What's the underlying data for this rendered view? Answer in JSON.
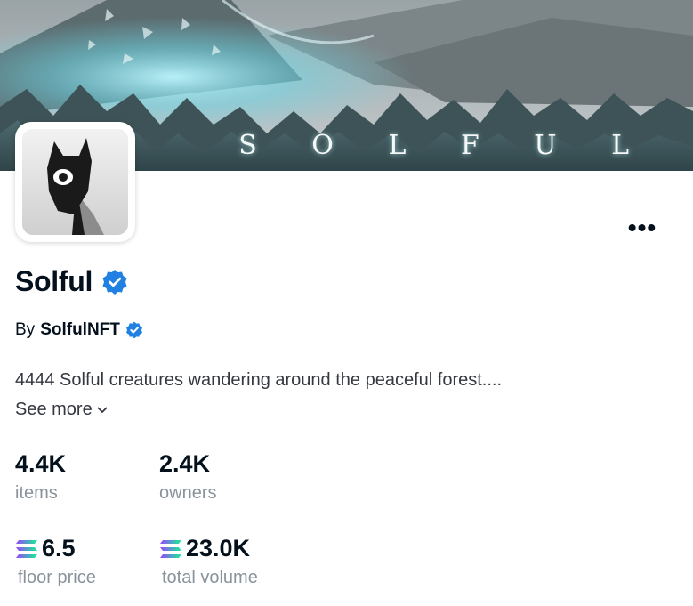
{
  "banner": {
    "wordmark": "S O L F U L"
  },
  "collection": {
    "name": "Solful",
    "by_prefix": "By",
    "creator": "SolfulNFT",
    "description": "4444 Solful creatures wandering around the peaceful forest....",
    "see_more": "See more"
  },
  "stats": {
    "items": {
      "value": "4.4K",
      "label": "items"
    },
    "owners": {
      "value": "2.4K",
      "label": "owners"
    },
    "floor_price": {
      "value": "6.5",
      "label": "floor price",
      "icon": "solana-icon"
    },
    "total_volume": {
      "value": "23.0K",
      "label": "total volume",
      "icon": "solana-icon"
    }
  },
  "colors": {
    "verified": "#2081e2",
    "text": "#04111d",
    "muted": "#8a939b",
    "solana_gradient": [
      "#9945ff",
      "#14f195"
    ]
  }
}
